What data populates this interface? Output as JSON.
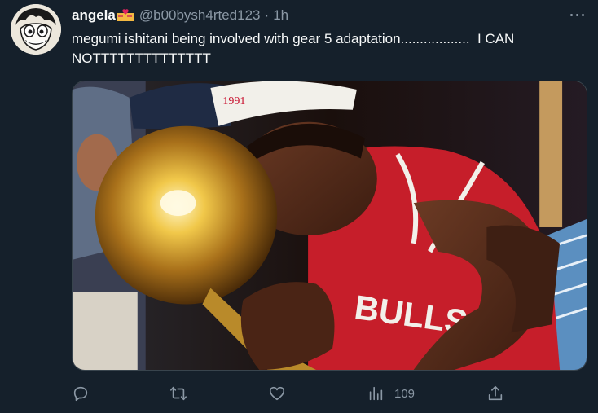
{
  "tweet": {
    "display_name": "angela",
    "handle": "@b00bysh4rted123",
    "separator": "·",
    "time": "1h",
    "text": "megumi ishitani being involved with gear 5 adaptation..................  I CAN NOTTTTTTTTTTTTTT",
    "avatar_icon": "luffy-cartoon-avatar",
    "name_badge_icon": "heart-badge-emoji"
  },
  "media": {
    "jersey_text": "BULLS",
    "cap_text": "1991"
  },
  "actions": {
    "reply_icon": "reply-icon",
    "retweet_icon": "retweet-icon",
    "like_icon": "like-icon",
    "views_icon": "views-icon",
    "views_count": "109",
    "share_icon": "share-icon"
  },
  "colors": {
    "background": "#15202b",
    "text": "#f7f9f9",
    "muted": "#8b98a5",
    "border": "#38444d"
  }
}
